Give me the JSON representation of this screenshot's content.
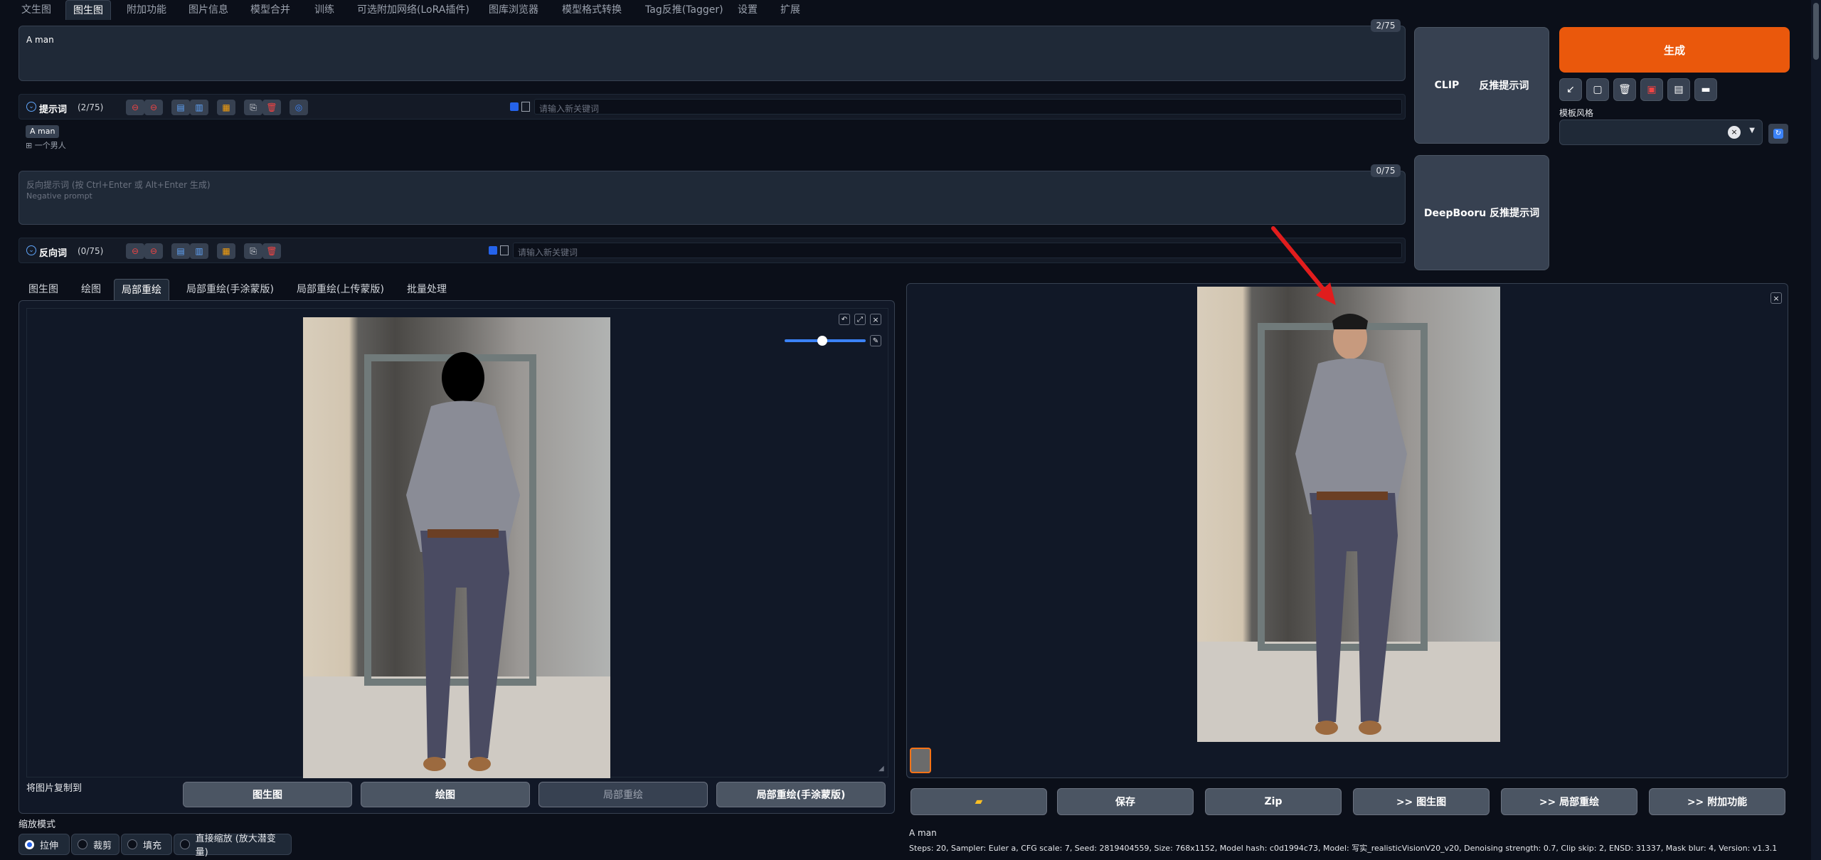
{
  "nav": {
    "tabs": [
      "文生图",
      "图生图",
      "附加功能",
      "图片信息",
      "模型合并",
      "训练",
      "可选附加网络(LoRA插件)",
      "图库浏览器",
      "模型格式转换",
      "Tag反推(Tagger)",
      "设置",
      "扩展"
    ],
    "active": "图生图"
  },
  "prompt": {
    "text": "A man",
    "counter": "2/75"
  },
  "prompt_bar": {
    "label": "提示词",
    "count": "(2/75)",
    "keyword_placeholder": "请输入新关键词",
    "tag": "A man",
    "tag_translation": "一个男人"
  },
  "negative": {
    "placeholder_line1": "反向提示词 (按 Ctrl+Enter 或 Alt+Enter 生成)",
    "placeholder_line2": "Negative prompt",
    "counter": "0/75"
  },
  "negative_bar": {
    "label": "反向词",
    "count": "(0/75)",
    "keyword_placeholder": "请输入新关键词"
  },
  "interrogate": {
    "clip_label": "CLIP",
    "clip_action": "反推提示词",
    "deepbooru_label": "DeepBooru 反推提示词"
  },
  "generate": {
    "label": "生成",
    "style_label": "模板风格"
  },
  "subtabs": {
    "items": [
      "图生图",
      "绘图",
      "局部重绘",
      "局部重绘(手涂蒙版)",
      "局部重绘(上传蒙版)",
      "批量处理"
    ],
    "active": "局部重绘"
  },
  "copy_to": {
    "label": "将图片复制到",
    "buttons": [
      "图生图",
      "绘图",
      "局部重绘",
      "局部重绘(手涂蒙版)"
    ]
  },
  "resize": {
    "label": "缩放模式",
    "options": [
      "拉伸",
      "裁剪",
      "填充",
      "直接缩放 (放大潜变量)"
    ],
    "selected": "拉伸"
  },
  "output": {
    "buttons": [
      "保存",
      "Zip",
      ">> 图生图",
      ">> 局部重绘",
      ">> 附加功能"
    ],
    "folder_icon": "folder-icon",
    "prompt": "A man",
    "info": "Steps: 20, Sampler: Euler a, CFG scale: 7, Seed: 2819404559, Size: 768x1152, Model hash: c0d1994c73, Model: 写实_realisticVisionV20_v20, Denoising strength: 0.7, Clip skip: 2, ENSD: 31337, Mask blur: 4, Version: v1.3.1"
  },
  "colors": {
    "background": "#0b0f19",
    "panel": "#1f2937",
    "accent": "#ea580c",
    "arrow": "#e11d1d"
  },
  "brush": {
    "value": 0.4
  }
}
